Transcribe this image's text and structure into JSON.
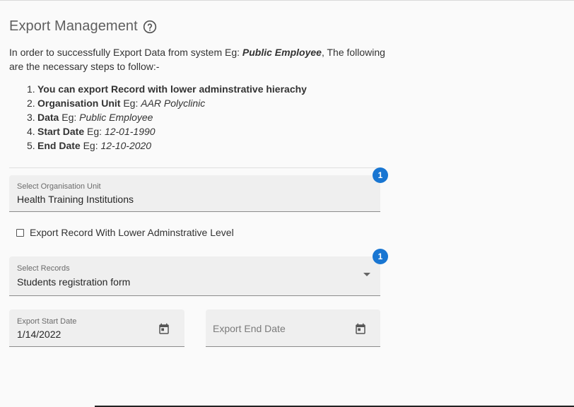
{
  "header": {
    "title": "Export Management",
    "help_icon": "help-circle-icon"
  },
  "intro": {
    "text_before": "In order to successfully Export Data from system Eg: ",
    "example": "Public Employee",
    "text_after": ", The following are the necessary steps to follow:-"
  },
  "steps": [
    {
      "number": "1.",
      "label": "You can export Record with lower adminstrative hierachy",
      "prefix": "",
      "example": ""
    },
    {
      "number": "2.",
      "label": "Organisation Unit",
      "prefix": " Eg: ",
      "example": "AAR Polyclinic"
    },
    {
      "number": "3.",
      "label": "Data",
      "prefix": " Eg: ",
      "example": "Public Employee"
    },
    {
      "number": "4.",
      "label": "Start Date",
      "prefix": " Eg: ",
      "example": "12-01-1990"
    },
    {
      "number": "5.",
      "label": "End Date",
      "prefix": " Eg: ",
      "example": "12-10-2020"
    }
  ],
  "org_unit": {
    "label": "Select Organisation Unit",
    "value": "Health Training Institutions",
    "badge": "1"
  },
  "lower_level": {
    "label": "Export Record With Lower Adminstrative Level",
    "checked": false
  },
  "records": {
    "label": "Select Records",
    "value": "Students registration form",
    "badge": "1"
  },
  "start_date": {
    "label": "Export Start Date",
    "value": "1/14/2022",
    "icon": "calendar-icon"
  },
  "end_date": {
    "placeholder": "Export End Date",
    "icon": "calendar-icon"
  },
  "colors": {
    "badge": "#1976d2",
    "field_bg": "#efefef",
    "page_bg": "#fafafa"
  }
}
